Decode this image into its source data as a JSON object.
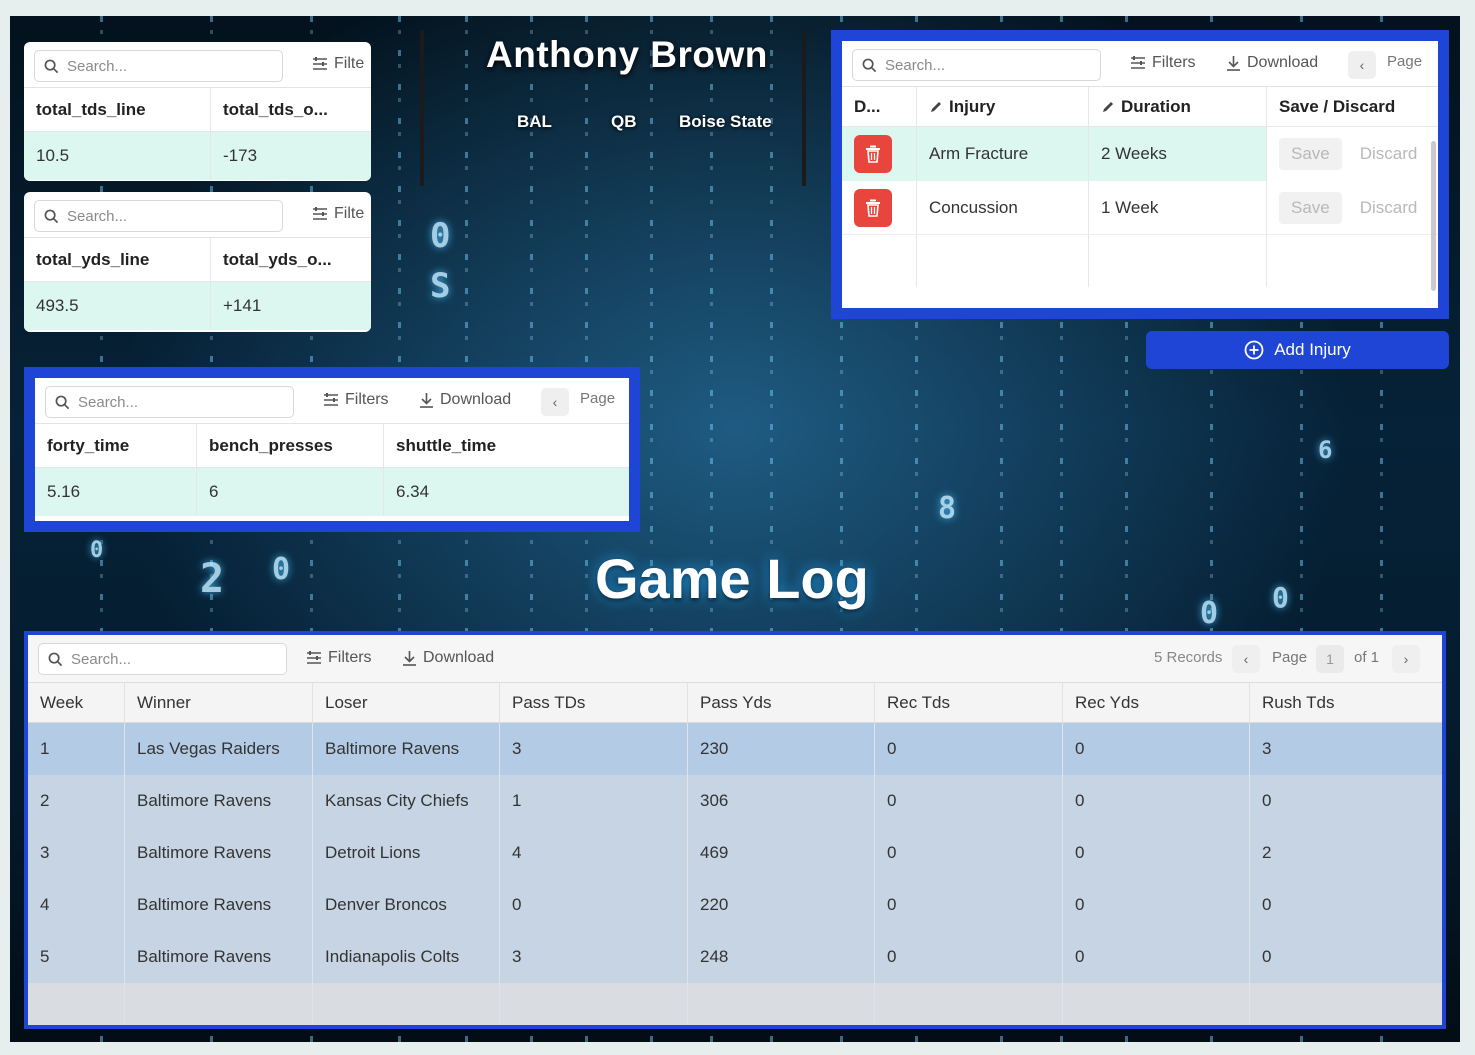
{
  "player": {
    "name": "Anthony Brown",
    "team": "BAL",
    "position": "QB",
    "college": "Boise State"
  },
  "common": {
    "search_placeholder": "Search...",
    "filters": "Filters",
    "filters_cut": "Filte",
    "download": "Download",
    "page": "Page"
  },
  "tds_card": {
    "headers": [
      "total_tds_line",
      "total_tds_o..."
    ],
    "values": [
      "10.5",
      "-173"
    ]
  },
  "yds_card": {
    "headers": [
      "total_yds_line",
      "total_yds_o..."
    ],
    "values": [
      "493.5",
      "+141"
    ]
  },
  "combine": {
    "headers": [
      "forty_time",
      "bench_presses",
      "shuttle_time"
    ],
    "values": [
      "5.16",
      "6",
      "6.34"
    ]
  },
  "injuries": {
    "headers": {
      "delete": "D...",
      "injury": "Injury",
      "duration": "Duration",
      "save_discard": "Save / Discard"
    },
    "rows": [
      {
        "injury": "Arm Fracture",
        "duration": "2 Weeks"
      },
      {
        "injury": "Concussion",
        "duration": "1 Week"
      }
    ],
    "save_label": "Save",
    "discard_label": "Discard",
    "add_label": "Add Injury"
  },
  "game_log": {
    "title": "Game Log",
    "records": "5 Records",
    "page_label": "Page",
    "page_current": "1",
    "page_of": "of 1",
    "columns": [
      "Week",
      "Winner",
      "Loser",
      "Pass TDs",
      "Pass Yds",
      "Rec Tds",
      "Rec Yds",
      "Rush Tds"
    ],
    "rows": [
      [
        "1",
        "Las Vegas Raiders",
        "Baltimore Ravens",
        "3",
        "230",
        "0",
        "0",
        "3"
      ],
      [
        "2",
        "Baltimore Ravens",
        "Kansas City Chiefs",
        "1",
        "306",
        "0",
        "0",
        "0"
      ],
      [
        "3",
        "Baltimore Ravens",
        "Detroit Lions",
        "4",
        "469",
        "0",
        "0",
        "2"
      ],
      [
        "4",
        "Baltimore Ravens",
        "Denver Broncos",
        "0",
        "220",
        "0",
        "0",
        "0"
      ],
      [
        "5",
        "Baltimore Ravens",
        "Indianapolis Colts",
        "3",
        "248",
        "0",
        "0",
        "0"
      ]
    ]
  },
  "colors": {
    "accent": "#1f45d6",
    "row_highlight": "#dcf7ef",
    "delete": "#e8453c",
    "log_row": "#c6d4e4"
  }
}
